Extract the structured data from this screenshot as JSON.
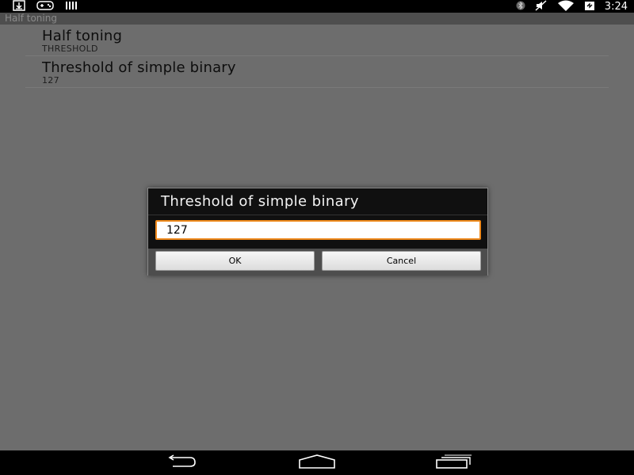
{
  "status_bar": {
    "time": "3:24",
    "left_icons": [
      "download-icon",
      "game-controller-icon",
      "barcode-icon"
    ],
    "right_icons": [
      "bluetooth-icon",
      "mute-icon",
      "wifi-icon",
      "battery-icon"
    ]
  },
  "app": {
    "title": "Half toning",
    "preferences": [
      {
        "title": "Half toning",
        "summary": "THRESHOLD"
      },
      {
        "title": "Threshold of simple binary",
        "summary": "127"
      }
    ]
  },
  "dialog": {
    "title": "Threshold of simple binary",
    "input_value": "127",
    "ok_label": "OK",
    "cancel_label": "Cancel",
    "input_border_color": "#f08a1c"
  },
  "nav_bar": {
    "icons": [
      "back-icon",
      "home-icon",
      "recents-icon"
    ]
  }
}
